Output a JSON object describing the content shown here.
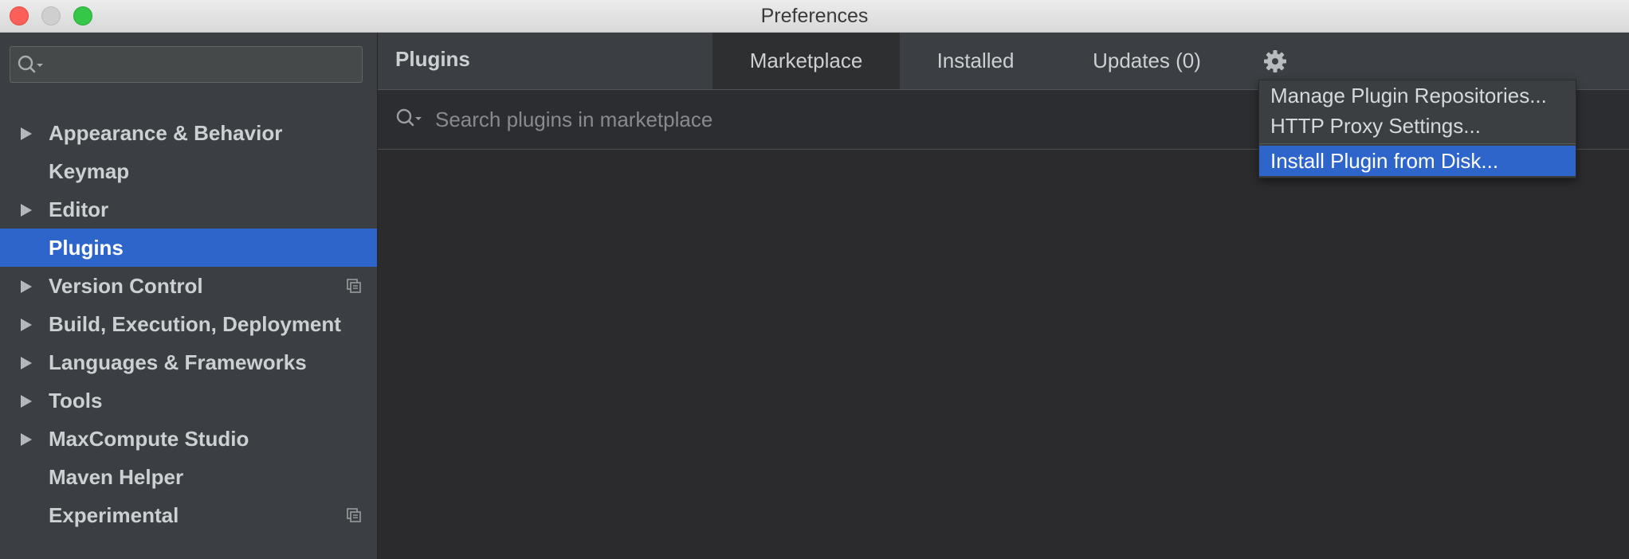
{
  "window": {
    "title": "Preferences"
  },
  "sidebar": {
    "search": {
      "placeholder": ""
    },
    "items": [
      {
        "label": "Appearance & Behavior",
        "expandable": true,
        "selected": false,
        "has_copy_icon": false
      },
      {
        "label": "Keymap",
        "expandable": false,
        "selected": false,
        "has_copy_icon": false
      },
      {
        "label": "Editor",
        "expandable": true,
        "selected": false,
        "has_copy_icon": false
      },
      {
        "label": "Plugins",
        "expandable": false,
        "selected": true,
        "has_copy_icon": false
      },
      {
        "label": "Version Control",
        "expandable": true,
        "selected": false,
        "has_copy_icon": true
      },
      {
        "label": "Build, Execution, Deployment",
        "expandable": true,
        "selected": false,
        "has_copy_icon": false
      },
      {
        "label": "Languages & Frameworks",
        "expandable": true,
        "selected": false,
        "has_copy_icon": false
      },
      {
        "label": "Tools",
        "expandable": true,
        "selected": false,
        "has_copy_icon": false
      },
      {
        "label": "MaxCompute Studio",
        "expandable": true,
        "selected": false,
        "has_copy_icon": false
      },
      {
        "label": "Maven Helper",
        "expandable": false,
        "selected": false,
        "has_copy_icon": false
      },
      {
        "label": "Experimental",
        "expandable": false,
        "selected": false,
        "has_copy_icon": true
      }
    ]
  },
  "header": {
    "title": "Plugins",
    "tabs": [
      {
        "label": "Marketplace",
        "active": true
      },
      {
        "label": "Installed",
        "active": false
      },
      {
        "label": "Updates (0)",
        "active": false
      }
    ],
    "settings_icon": "gear-icon"
  },
  "search": {
    "placeholder": "Search plugins in marketplace",
    "value": ""
  },
  "menu": {
    "items": [
      {
        "label": "Manage Plugin Repositories...",
        "highlighted": false
      },
      {
        "label": "HTTP Proxy Settings...",
        "highlighted": false
      },
      {
        "label": "Install Plugin from Disk...",
        "highlighted": true
      }
    ]
  },
  "colors": {
    "selection": "#2e65ca",
    "sidebar_bg": "#3b3f43",
    "panel_bg": "#2b2b2d"
  }
}
